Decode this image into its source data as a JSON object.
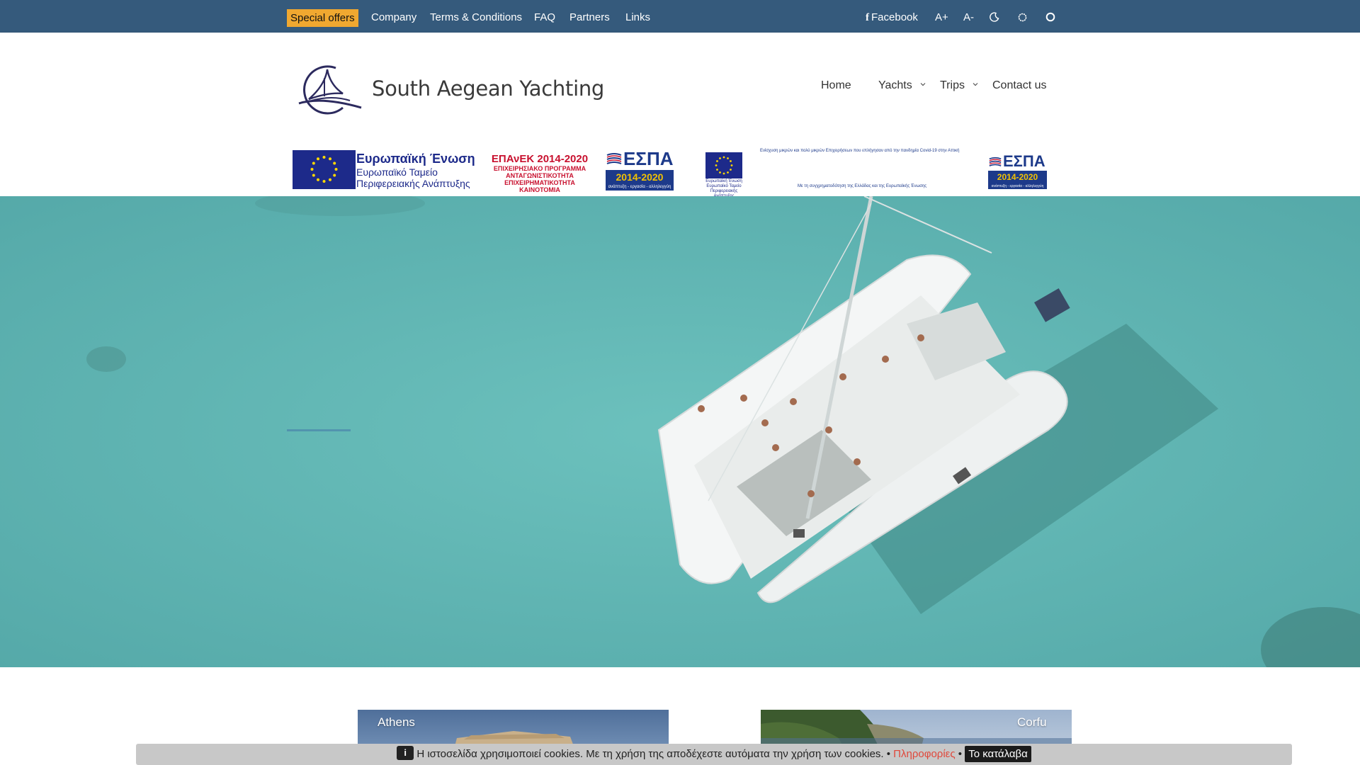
{
  "topbar": {
    "special_offers": "Special offers",
    "links": [
      "Company",
      "Terms & Conditions",
      "FAQ",
      "Partners",
      "Links"
    ],
    "facebook": "Facebook",
    "font_increase": "A+",
    "font_decrease": "A-"
  },
  "header": {
    "site_name": "South Aegean Yachting",
    "nav": {
      "home": "Home",
      "yachts": "Yachts",
      "trips": "Trips",
      "contact": "Contact us"
    }
  },
  "eu_banner": {
    "eu_title": "Ευρωπαϊκή Ένωση",
    "eu_fund_1": "Ευρωπαϊκό Ταμείο",
    "eu_fund_2": "Περιφερειακής Ανάπτυξης",
    "epanek_title": "ΕΠΑνΕΚ 2014-2020",
    "epanek_line_1": "ΕΠΙΧΕΙΡΗΣΙΑΚΟ ΠΡΟΓΡΑΜΜΑ",
    "epanek_line_2": "ΑΝΤΑΓΩΝΙΣΤΙΚΟΤΗΤΑ",
    "epanek_line_3": "ΕΠΙΧΕΙΡΗΜΑΤΙΚΟΤΗΤΑ",
    "epanek_line_4": "ΚΑΙΝΟΤΟΜΙΑ",
    "espa": "ΕΣΠΑ",
    "espa_years": "2014-2020",
    "espa_tagline": "ανάπτυξη - εργασία - αλληλεγγύη",
    "eu_small_1": "Ευρωπαϊκή Ένωση",
    "eu_small_2": "Ευρωπαϊκό Ταμείο",
    "eu_small_3": "Περιφερειακής Ανάπτυξης",
    "covid_line": "Ενίσχυση μικρών και πολύ μικρών Επιχειρήσεων που επλήγησαν από την πανδημία Covid-19 στην Αττική",
    "cofunding_line": "Με τη συγχρηματοδότηση της Ελλάδας και της Ευρωπαϊκής Ένωσης"
  },
  "destinations": [
    {
      "label": "Athens"
    },
    {
      "label": "Corfu"
    }
  ],
  "cookie_bar": {
    "message": "Η ιστοσελίδα χρησιμοποιεί cookies. Με τη χρήση της αποδέχεστε αυτόματα την χρήση των cookies. •",
    "info_link": "Πληροφορίες",
    "separator": "•",
    "accept_button": "Το κατάλαβα"
  },
  "colors": {
    "topbar_bg": "#355a7c",
    "special_offers_bg": "#f0a830",
    "logo_navy": "#2c2a5e",
    "sea": "#5fb3b1",
    "cookie_link": "#e0473a"
  }
}
